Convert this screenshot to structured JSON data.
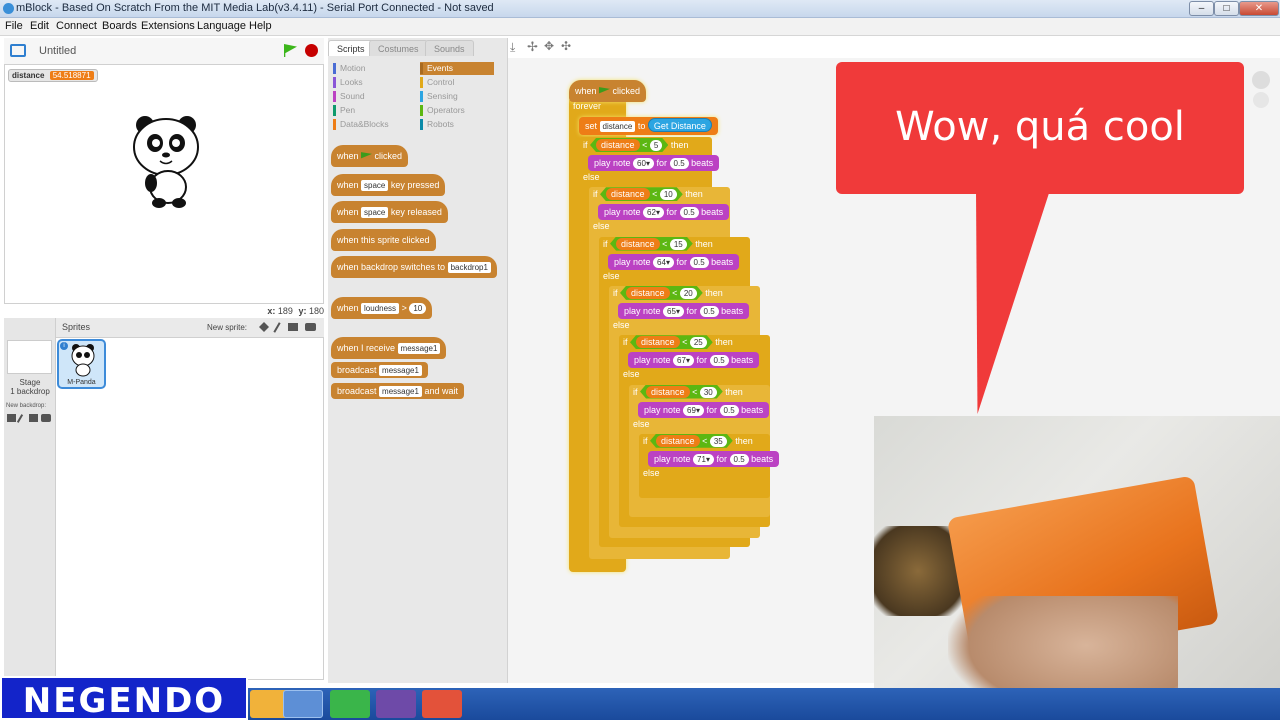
{
  "window": {
    "title": "mBlock - Based On Scratch From the MIT Media Lab(v3.4.11) - Serial Port Connected - Not saved",
    "min": "–",
    "max": "□",
    "close": "✕"
  },
  "menu": [
    "File",
    "Edit",
    "Connect",
    "Boards",
    "Extensions",
    "Language",
    "Help"
  ],
  "stage": {
    "project_title": "Untitled",
    "variable_monitor": {
      "name": "distance",
      "value": "54.518871"
    },
    "coords_x_label": "x:",
    "coords_x": "189",
    "coords_y_label": "y:",
    "coords_y": "180"
  },
  "sprites": {
    "header": "Sprites",
    "new_sprite_label": "New sprite:",
    "stage_label": "Stage",
    "stage_backdrops": "1 backdrop",
    "new_backdrop_label": "New backdrop:",
    "sprite_name": "M-Panda"
  },
  "tabs": [
    "Scripts",
    "Costumes",
    "Sounds"
  ],
  "categories": [
    {
      "label": "Motion",
      "color": "#4a6cd4"
    },
    {
      "label": "Looks",
      "color": "#8a55d7"
    },
    {
      "label": "Sound",
      "color": "#bb42c3"
    },
    {
      "label": "Pen",
      "color": "#0e9a6c"
    },
    {
      "label": "Data&Blocks",
      "color": "#ee7d16"
    },
    {
      "label": "Events",
      "color": "#c88330"
    },
    {
      "label": "Control",
      "color": "#e1a91a"
    },
    {
      "label": "Sensing",
      "color": "#2ca5e2"
    },
    {
      "label": "Operators",
      "color": "#5cb712"
    },
    {
      "label": "Robots",
      "color": "#0b8aa8"
    }
  ],
  "palette": {
    "when": "when",
    "clicked": "clicked",
    "key_pressed": "key pressed",
    "key_released": "key released",
    "space": "space",
    "sprite_clicked": "when this sprite clicked",
    "backdrop_switches": "when backdrop switches to",
    "backdrop1": "backdrop1",
    "loudness": "loudness",
    "gt": ">",
    "ten": "10",
    "when_receive": "when I receive",
    "message1": "message1",
    "broadcast": "broadcast",
    "and_wait": "and wait"
  },
  "script": {
    "when": "when",
    "clicked": "clicked",
    "forever": "forever",
    "set": "set",
    "distance": "distance",
    "to": "to",
    "get_distance": "Get Distance",
    "if": "if",
    "then": "then",
    "else": "else",
    "lt": "<",
    "play_note": "play note",
    "for": "for",
    "beats": "beats",
    "branches": [
      {
        "threshold": "5",
        "note": "60",
        "beats": "0.5"
      },
      {
        "threshold": "10",
        "note": "62",
        "beats": "0.5"
      },
      {
        "threshold": "15",
        "note": "64",
        "beats": "0.5"
      },
      {
        "threshold": "20",
        "note": "65",
        "beats": "0.5"
      },
      {
        "threshold": "25",
        "note": "67",
        "beats": "0.5"
      },
      {
        "threshold": "30",
        "note": "69",
        "beats": "0.5"
      },
      {
        "threshold": "35",
        "note": "71",
        "beats": "0.5"
      }
    ]
  },
  "overlay": {
    "bubble_text": "Wow, quá cool",
    "brand": "NEGENDO"
  }
}
